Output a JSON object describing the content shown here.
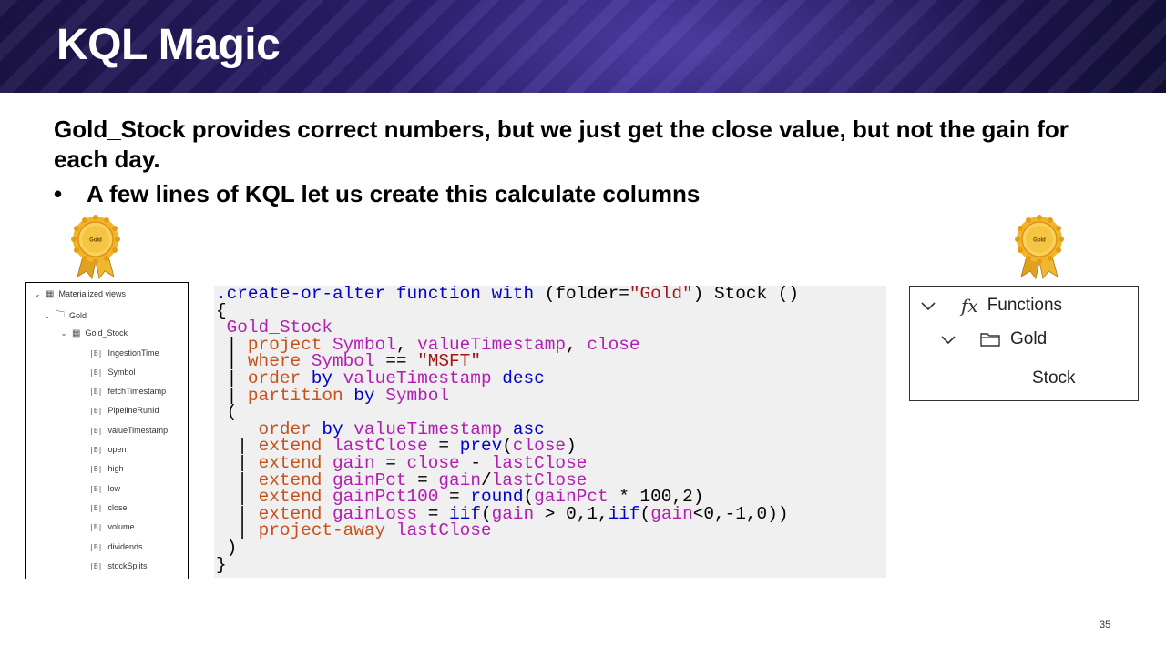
{
  "slide": {
    "title": "KQL Magic",
    "intro": "Gold_Stock provides correct numbers, but we just get the close value, but not the gain for each day.",
    "bullet_symbol": "•",
    "bullet": "A few lines of KQL let us create this calculate columns",
    "page_number": "35",
    "medal_text": "Gold"
  },
  "tree": {
    "root": "Materialized views",
    "folder": "Gold",
    "table": "Gold_Stock",
    "columns": [
      "IngestionTime",
      "Symbol",
      "fetchTimestamp",
      "PipelineRunId",
      "valueTimestamp",
      "open",
      "high",
      "low",
      "close",
      "volume",
      "dividends",
      "stockSplits"
    ]
  },
  "code": {
    "l1": [
      ".create-or-alter",
      "function",
      "with",
      "(folder=",
      "\"Gold\"",
      ") Stock ()"
    ],
    "l2": [
      "{"
    ],
    "l3": [
      "Gold_Stock"
    ],
    "l4": [
      "|",
      "project",
      "Symbol",
      ",",
      "valueTimestamp",
      ",",
      "close"
    ],
    "l5": [
      "|",
      "where",
      "Symbol",
      "==",
      "\"MSFT\""
    ],
    "l6": [
      "|",
      "order",
      "by",
      "valueTimestamp",
      "desc"
    ],
    "l7": [
      "|",
      "partition",
      "by",
      "Symbol"
    ],
    "l8": [
      "("
    ],
    "l9": [
      "order",
      "by",
      "valueTimestamp",
      "asc"
    ],
    "l10": [
      "|",
      "extend",
      "lastClose",
      "=",
      "prev",
      "(",
      "close",
      ")"
    ],
    "l11": [
      "|",
      "extend",
      "gain",
      "=",
      "close",
      "-",
      "lastClose"
    ],
    "l12": [
      "|",
      "extend",
      "gainPct",
      "=",
      "gain",
      "/",
      "lastClose"
    ],
    "l13": [
      "|",
      "extend",
      "gainPct100",
      "=",
      "round",
      "(",
      "gainPct",
      "* 100,2)"
    ],
    "l14": [
      "|",
      "extend",
      "gainLoss",
      "=",
      "iif",
      "(",
      "gain",
      "> 0,1,",
      "iif",
      "(",
      "gain",
      "<0,-1,0))"
    ],
    "l15": [
      "|",
      "project-away",
      "lastClose"
    ],
    "l16": [
      ")"
    ],
    "l17": [
      "}"
    ]
  },
  "functions_panel": {
    "root": "Functions",
    "root_icon": "fx",
    "folder": "Gold",
    "item": "Stock"
  }
}
